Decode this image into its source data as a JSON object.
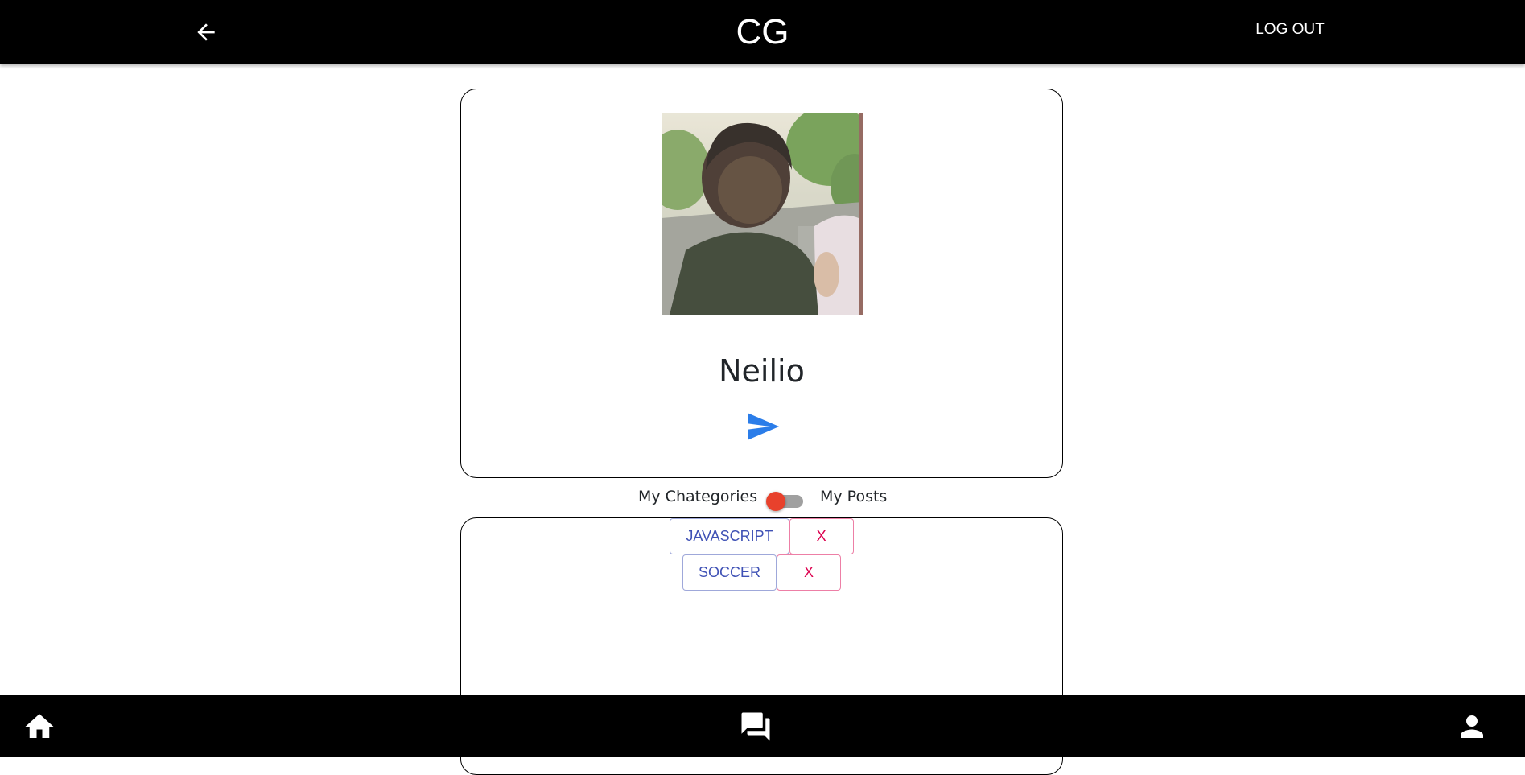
{
  "header": {
    "title": "CG",
    "back_icon": "arrow-left-icon",
    "logout_label": "LOG OUT"
  },
  "profile": {
    "username": "Neilio",
    "avatar": "user-photo",
    "send_icon": "send-icon"
  },
  "toggle": {
    "left_label": "My Chategories",
    "right_label": "My Posts",
    "state": "off"
  },
  "categories": [
    {
      "label": "JAVASCRIPT",
      "remove_label": "X"
    },
    {
      "label": "SOCCER",
      "remove_label": "X"
    }
  ],
  "bottom_nav": {
    "items": [
      {
        "icon": "home-icon"
      },
      {
        "icon": "forum-icon"
      },
      {
        "icon": "person-icon"
      }
    ]
  },
  "colors": {
    "bar_background": "#000000",
    "send_icon": "#2b7de9",
    "toggle_thumb": "#e8412c",
    "category_primary": "#3f51b5",
    "category_remove": "#dc004e"
  }
}
